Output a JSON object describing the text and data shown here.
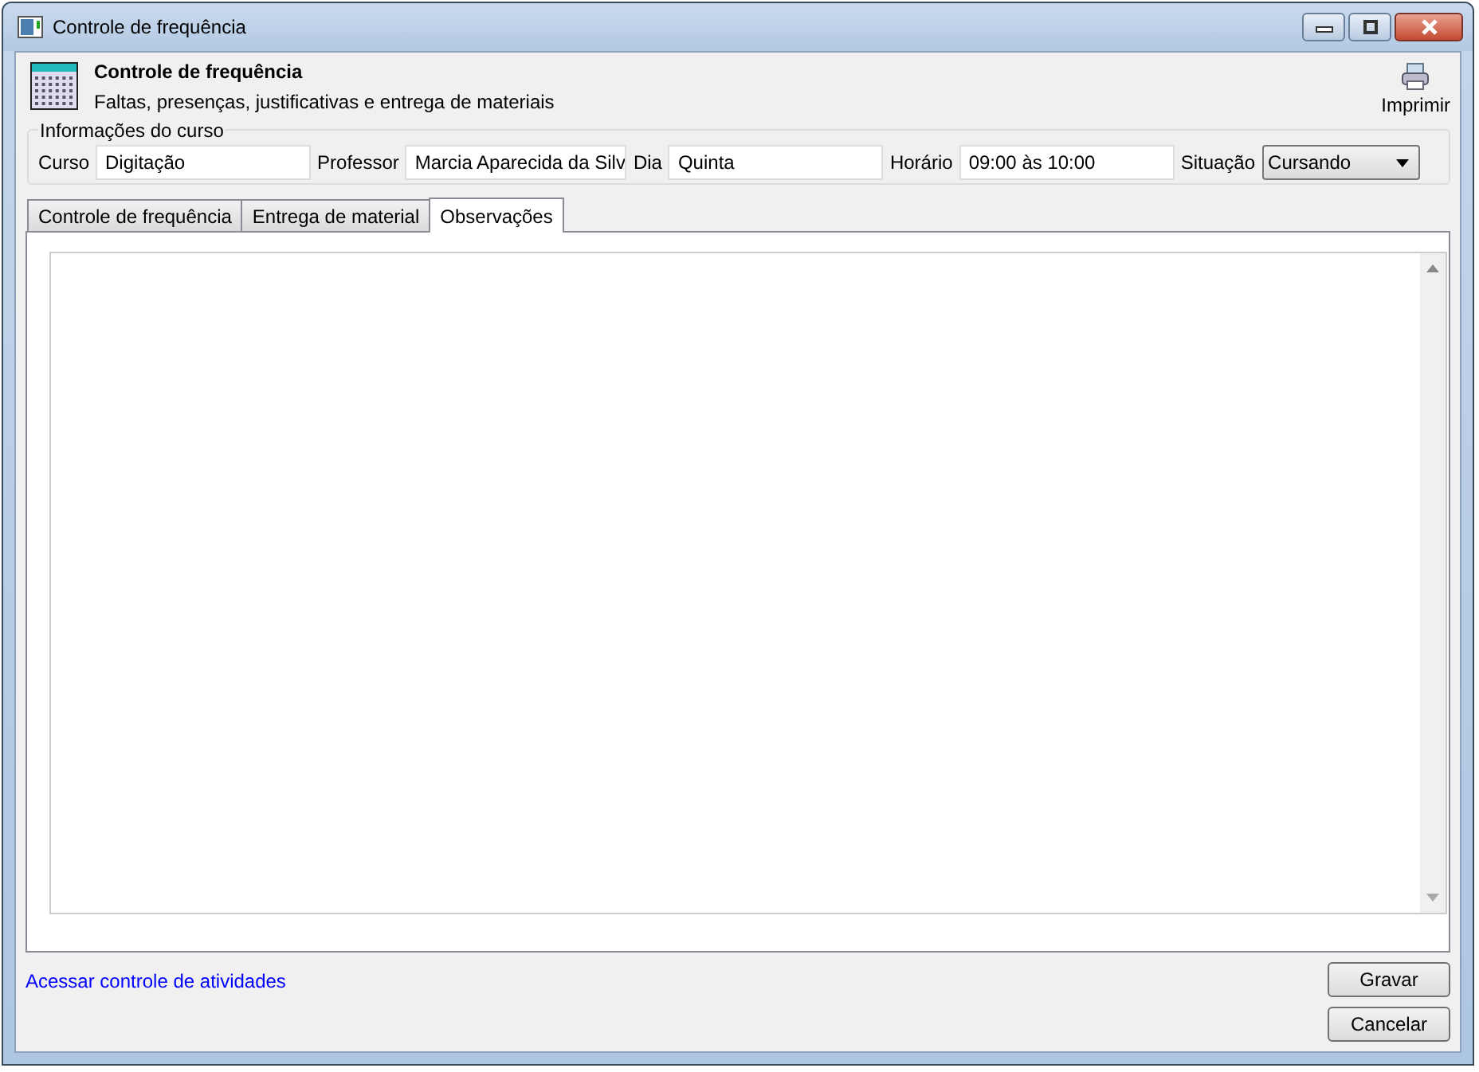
{
  "window": {
    "title": "Controle de frequência"
  },
  "header": {
    "title": "Controle de frequência",
    "subtitle": "Faltas, presenças, justificativas e entrega de materiais",
    "print_label": "Imprimir"
  },
  "course_info": {
    "legend": "Informações do curso",
    "fields": [
      {
        "kind": "text",
        "label": "Curso",
        "value": "Digitação"
      },
      {
        "kind": "text",
        "label": "Professor",
        "value": "Marcia Aparecida da Silv"
      },
      {
        "kind": "text",
        "label": "Dia",
        "value": "Quinta"
      },
      {
        "kind": "text",
        "label": "Horário",
        "value": "09:00 às 10:00"
      },
      {
        "kind": "select",
        "label": "Situação",
        "value": "Cursando"
      }
    ]
  },
  "tabs": [
    {
      "label": "Controle de frequência",
      "selected": false
    },
    {
      "label": "Entrega de material",
      "selected": false
    },
    {
      "label": "Observações",
      "selected": true
    }
  ],
  "link": "Acessar controle de atividades",
  "buttons": [
    "Gravar",
    "Cancelar"
  ]
}
